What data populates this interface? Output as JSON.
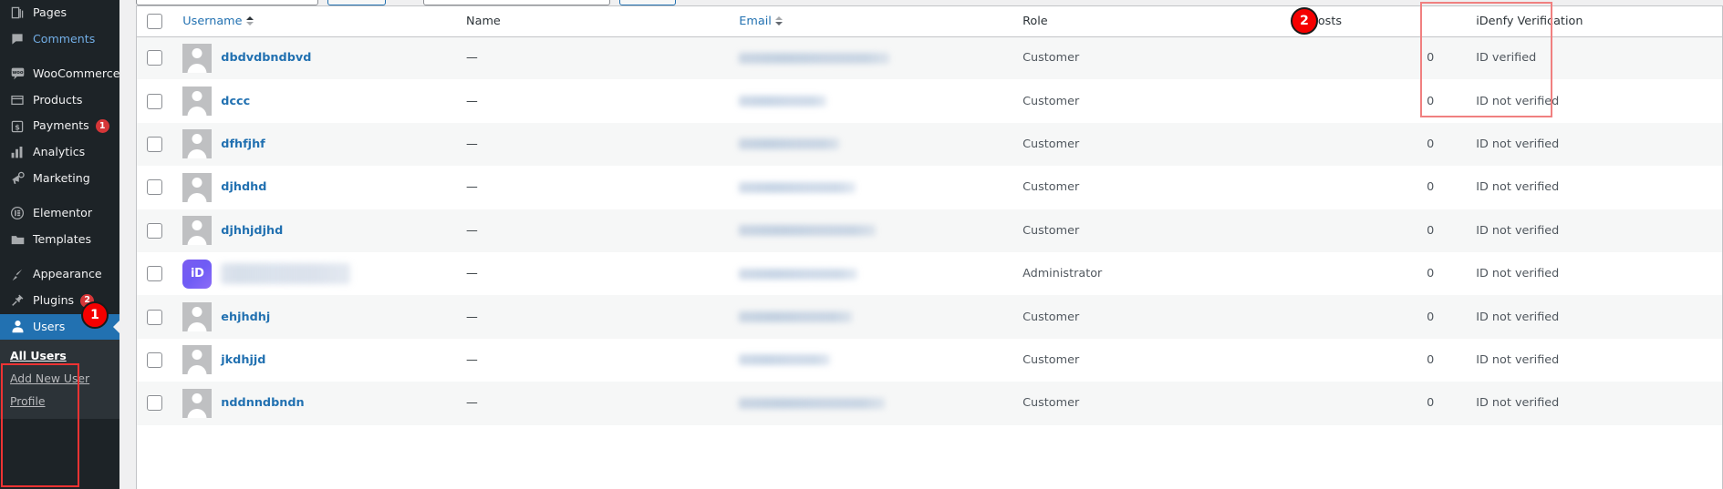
{
  "sidebar": {
    "items": [
      {
        "label": "Pages",
        "icon": "pages-icon",
        "style": "normal",
        "count": null
      },
      {
        "label": "Comments",
        "icon": "comments-icon",
        "style": "link",
        "count": null
      },
      {
        "label": "__SEP__",
        "icon": "",
        "style": "sep",
        "count": null
      },
      {
        "label": "WooCommerce",
        "icon": "woocommerce-icon",
        "style": "normal",
        "count": null
      },
      {
        "label": "Products",
        "icon": "products-icon",
        "style": "normal",
        "count": null
      },
      {
        "label": "Payments",
        "icon": "payments-icon",
        "style": "normal",
        "count": "1"
      },
      {
        "label": "Analytics",
        "icon": "analytics-icon",
        "style": "normal",
        "count": null
      },
      {
        "label": "Marketing",
        "icon": "marketing-icon",
        "style": "normal",
        "count": null
      },
      {
        "label": "__SEP__",
        "icon": "",
        "style": "sep",
        "count": null
      },
      {
        "label": "Elementor",
        "icon": "elementor-icon",
        "style": "normal",
        "count": null
      },
      {
        "label": "Templates",
        "icon": "templates-icon",
        "style": "normal",
        "count": null
      },
      {
        "label": "__SEP__",
        "icon": "",
        "style": "sep",
        "count": null
      },
      {
        "label": "Appearance",
        "icon": "appearance-icon",
        "style": "normal",
        "count": null
      },
      {
        "label": "Plugins",
        "icon": "plugins-icon",
        "style": "normal",
        "count": "2"
      }
    ],
    "current": {
      "label": "Users",
      "icon": "users-icon"
    },
    "submenu": [
      {
        "label": "All Users",
        "current": true
      },
      {
        "label": "Add New User",
        "current": false
      },
      {
        "label": "Profile",
        "current": false
      }
    ]
  },
  "table": {
    "columns": {
      "cb": "",
      "username": "Username",
      "name": "Name",
      "email": "Email",
      "role": "Role",
      "posts": "Posts",
      "idenfy": "iDenfy Verification"
    },
    "rows": [
      {
        "username": "dbdvdbndbvd",
        "username_blurred": false,
        "avatar": "default-avatar",
        "name": "—",
        "email": "",
        "email_blurred": true,
        "email_width": 165,
        "role": "Customer",
        "posts": "0",
        "idenfy": "ID verified"
      },
      {
        "username": "dccc",
        "username_blurred": false,
        "avatar": "default-avatar",
        "name": "—",
        "email": "",
        "email_blurred": true,
        "email_width": 96,
        "role": "Customer",
        "posts": "0",
        "idenfy": "ID not verified"
      },
      {
        "username": "dfhfjhf",
        "username_blurred": false,
        "avatar": "default-avatar",
        "name": "—",
        "email": "",
        "email_blurred": true,
        "email_width": 110,
        "role": "Customer",
        "posts": "0",
        "idenfy": "ID not verified"
      },
      {
        "username": "djhdhd",
        "username_blurred": false,
        "avatar": "default-avatar",
        "name": "—",
        "email": "",
        "email_blurred": true,
        "email_width": 128,
        "role": "Customer",
        "posts": "0",
        "idenfy": "ID not verified"
      },
      {
        "username": "djhhjdjhd",
        "username_blurred": false,
        "avatar": "default-avatar",
        "name": "—",
        "email": "",
        "email_blurred": true,
        "email_width": 150,
        "role": "Customer",
        "posts": "0",
        "idenfy": "ID not verified"
      },
      {
        "username": "",
        "username_blurred": true,
        "avatar": "idenfy-avatar",
        "name": "—",
        "email": "",
        "email_blurred": true,
        "email_width": 130,
        "role": "Administrator",
        "posts": "0",
        "idenfy": "ID not verified"
      },
      {
        "username": "ehjhdhj",
        "username_blurred": false,
        "avatar": "default-avatar",
        "name": "—",
        "email": "",
        "email_blurred": true,
        "email_width": 124,
        "role": "Customer",
        "posts": "0",
        "idenfy": "ID not verified"
      },
      {
        "username": "jkdhjjd",
        "username_blurred": false,
        "avatar": "default-avatar",
        "name": "—",
        "email": "",
        "email_blurred": true,
        "email_width": 100,
        "role": "Customer",
        "posts": "0",
        "idenfy": "ID not verified"
      },
      {
        "username": "nddnndbndn",
        "username_blurred": false,
        "avatar": "default-avatar",
        "name": "—",
        "email": "",
        "email_blurred": true,
        "email_width": 160,
        "role": "Customer",
        "posts": "0",
        "idenfy": "ID not verified"
      }
    ]
  },
  "annotations": [
    {
      "number": "1",
      "target": "users-menu"
    },
    {
      "number": "2",
      "target": "idenfy-column"
    }
  ],
  "colors": {
    "accent_blue": "#2271b1",
    "sidebar_bg": "#1d2327",
    "submenu_bg": "#2c3338",
    "badge_red": "#f50000",
    "annotation_red": "#e33333",
    "annotation_salmon": "#f08080",
    "idenfy_purple": "#6f5cf5"
  }
}
